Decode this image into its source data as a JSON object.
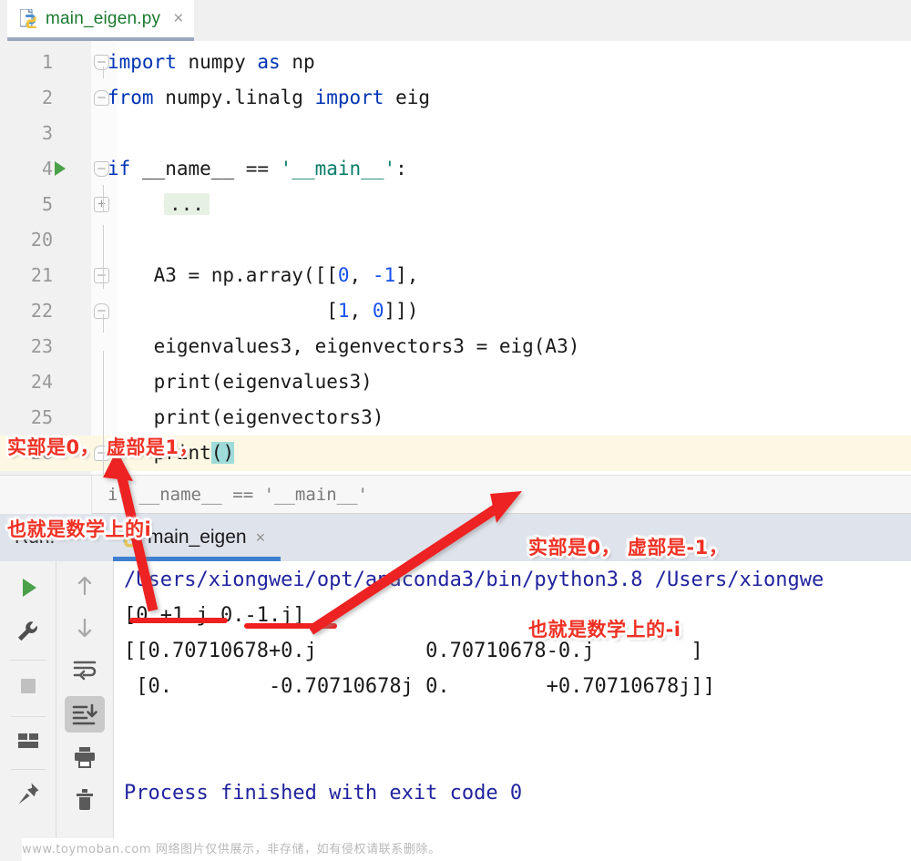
{
  "editor_tab": {
    "filename": "main_eigen.py",
    "icon": "python-file-icon",
    "close_label": "×"
  },
  "code": {
    "lines": [
      {
        "num": "1",
        "fold": "top",
        "run": false,
        "indent": 0,
        "tokens": [
          {
            "t": "import",
            "c": "kw"
          },
          {
            "t": " numpy ",
            "c": "plain"
          },
          {
            "t": "as",
            "c": "kw"
          },
          {
            "t": " np",
            "c": "plain"
          }
        ]
      },
      {
        "num": "2",
        "fold": "bot",
        "run": false,
        "indent": 0,
        "tokens": [
          {
            "t": "from",
            "c": "kw"
          },
          {
            "t": " numpy.linalg ",
            "c": "plain"
          },
          {
            "t": "import",
            "c": "kw"
          },
          {
            "t": " eig",
            "c": "plain"
          }
        ]
      },
      {
        "num": "3",
        "fold": "",
        "run": false,
        "indent": 0,
        "tokens": []
      },
      {
        "num": "4",
        "fold": "top",
        "run": true,
        "indent": 0,
        "tokens": [
          {
            "t": "if",
            "c": "kw"
          },
          {
            "t": " __name__ == ",
            "c": "plain"
          },
          {
            "t": "'__main__'",
            "c": "str"
          },
          {
            "t": ":",
            "c": "plain"
          }
        ]
      },
      {
        "num": "5",
        "fold": "plus",
        "run": false,
        "indent": 1,
        "folded_text": "..."
      },
      {
        "num": "20",
        "fold": "",
        "run": false,
        "indent": 0,
        "tokens": []
      },
      {
        "num": "21",
        "fold": "round",
        "run": false,
        "indent": 1,
        "tokens": [
          {
            "t": "    A3 = np.array([[",
            "c": "plain"
          },
          {
            "t": "0",
            "c": "num-lit"
          },
          {
            "t": ", ",
            "c": "plain"
          },
          {
            "t": "-1",
            "c": "num-lit"
          },
          {
            "t": "],",
            "c": "plain"
          }
        ]
      },
      {
        "num": "22",
        "fold": "bot",
        "run": false,
        "indent": 1,
        "tokens": [
          {
            "t": "                   [",
            "c": "plain"
          },
          {
            "t": "1",
            "c": "num-lit"
          },
          {
            "t": ", ",
            "c": "plain"
          },
          {
            "t": "0",
            "c": "num-lit"
          },
          {
            "t": "]])",
            "c": "plain"
          }
        ]
      },
      {
        "num": "23",
        "fold": "",
        "run": false,
        "indent": 1,
        "tokens": [
          {
            "t": "    eigenvalues3, eigenvectors3 = eig(A3)",
            "c": "plain"
          }
        ]
      },
      {
        "num": "24",
        "fold": "",
        "run": false,
        "indent": 1,
        "tokens": [
          {
            "t": "    print(eigenvalues3)",
            "c": "plain"
          }
        ]
      },
      {
        "num": "25",
        "fold": "",
        "run": false,
        "indent": 1,
        "tokens": [
          {
            "t": "    print(eigenvectors3)",
            "c": "plain"
          }
        ]
      },
      {
        "num": "26",
        "fold": "bot",
        "run": false,
        "indent": 1,
        "current": true,
        "tokens": [
          {
            "t": "    print",
            "c": "plain"
          },
          {
            "t": "()",
            "c": "brmatch"
          }
        ]
      }
    ]
  },
  "breadcrumb": {
    "text": "if __name__ == '__main__'"
  },
  "run_panel": {
    "label": "Run:",
    "tab_name": "main_eigen",
    "tab_icon": "python-icon",
    "tab_close": "×",
    "toolbar_left": [
      {
        "name": "rerun-icon",
        "glyph": "run"
      },
      {
        "name": "settings-icon",
        "glyph": "wrench"
      },
      {
        "name": "stop-icon",
        "glyph": "stop"
      },
      {
        "name": "layout-icon",
        "glyph": "layout"
      },
      {
        "name": "pin-icon",
        "glyph": "pin"
      }
    ],
    "toolbar_right": [
      {
        "name": "up-arrow-icon",
        "glyph": "up"
      },
      {
        "name": "down-arrow-icon",
        "glyph": "down"
      },
      {
        "name": "soft-wrap-icon",
        "glyph": "wrap"
      },
      {
        "name": "scroll-to-end-icon",
        "glyph": "scrollend",
        "active": true
      },
      {
        "name": "print-icon",
        "glyph": "printer"
      },
      {
        "name": "clear-all-icon",
        "glyph": "trash"
      }
    ]
  },
  "console": {
    "lines": [
      {
        "text": "/Users/xiongwei/opt/anaconda3/bin/python3.8 /Users/xiongwe",
        "style": "c-link"
      },
      {
        "text": "[0.+1.j 0.-1.j]",
        "style": "c-plain"
      },
      {
        "text": "[[0.70710678+0.j         0.70710678-0.j        ]",
        "style": "c-plain"
      },
      {
        "text": " [0.        -0.70710678j 0.        +0.70710678j]]",
        "style": "c-plain"
      },
      {
        "text": "",
        "style": "c-plain"
      },
      {
        "text": "",
        "style": "c-plain"
      },
      {
        "text": "Process finished with exit code 0",
        "style": "c-final"
      }
    ]
  },
  "annotations": [
    {
      "name": "annotation-positive-i",
      "line1": "实部是0， 虚部是1，",
      "line2": "也就是数学上的i"
    },
    {
      "name": "annotation-negative-i",
      "line1": "实部是0， 虚部是-1，",
      "line2": "也就是数学上的-i"
    }
  ],
  "watermark": {
    "text": "www.toymoban.com 网络图片仅供展示，非存储，如有侵权请联系删除。"
  },
  "colors": {
    "accent_blue": "#3f7fd0",
    "annotation_red": "#ef3124",
    "keyword_blue": "#0033b3",
    "string_green": "#067d68",
    "console_link": "#21239e",
    "tab_filename_green": "#1a7a2e"
  }
}
